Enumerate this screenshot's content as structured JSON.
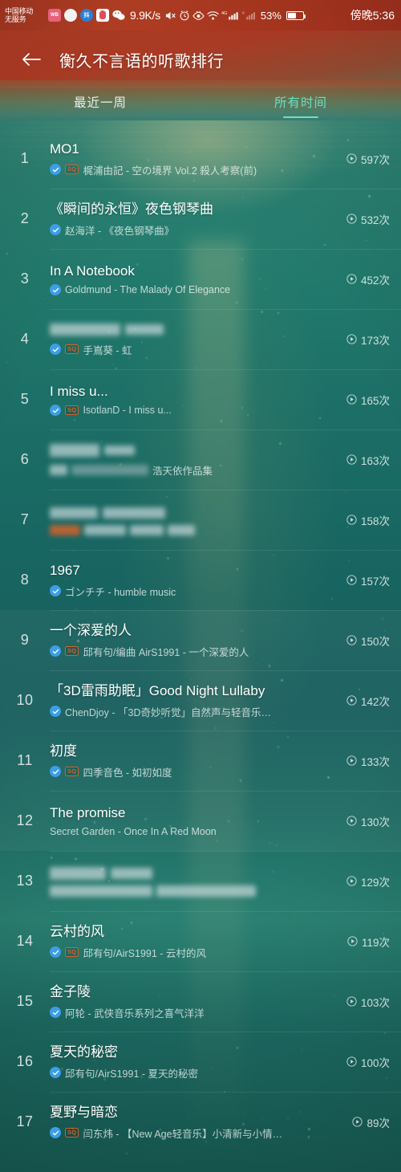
{
  "status_bar": {
    "carrier_line1": "中国移动",
    "carrier_line2": "无服务",
    "network_speed": "9.9K/s",
    "battery_percent": "53%",
    "clock": "傍晚5:36",
    "signal_label_1": "4G",
    "signal_label_2": "✕",
    "notification_icons": [
      "weibo-icon",
      "message-icon",
      "douyin-icon",
      "qq-icon",
      "wechat-icon"
    ],
    "system_icons": [
      "mute-icon",
      "alarm-icon",
      "eye-care-icon",
      "wifi-icon",
      "signal-4g-icon",
      "signal-second-icon",
      "battery-icon"
    ]
  },
  "header": {
    "back_icon": "back-arrow-icon",
    "title": "衡久不言语的听歌排行"
  },
  "tabs": [
    {
      "label": "最近一周",
      "active": false
    },
    {
      "label": "所有时间",
      "active": true
    }
  ],
  "theme": {
    "accent": "#66e3c4",
    "verified_blue": "#3c9ee8",
    "sq_orange": "#d4622a",
    "status_red": "#b93f27",
    "sea_teal": "#186561"
  },
  "plays_unit": "次",
  "songs": [
    {
      "rank": "1",
      "title": "MO1",
      "title_blurred": false,
      "verified": true,
      "sq": true,
      "sq_label": "SQ",
      "artist": "梶浦由記 - 空の境界 Vol.2 殺人考察(前)",
      "artist_blurred": false,
      "plays": "597次",
      "highlight": false
    },
    {
      "rank": "2",
      "title": "《瞬间的永恒》夜色钢琴曲",
      "title_blurred": false,
      "verified": true,
      "sq": false,
      "sq_label": "",
      "artist": "赵海洋 - 《夜色钢琴曲》",
      "artist_blurred": false,
      "plays": "532次",
      "highlight": false
    },
    {
      "rank": "3",
      "title": "In A Notebook",
      "title_blurred": false,
      "verified": true,
      "sq": false,
      "sq_label": "",
      "artist": "Goldmund - The Malady Of Elegance",
      "artist_blurred": false,
      "plays": "452次",
      "highlight": false
    },
    {
      "rank": "4",
      "title": "",
      "title_blurred": true,
      "verified": true,
      "sq": true,
      "sq_label": "SQ",
      "artist": "手嶌葵 - 虹",
      "artist_blurred": false,
      "plays": "173次",
      "highlight": false
    },
    {
      "rank": "5",
      "title": "I miss u...",
      "title_blurred": false,
      "verified": true,
      "sq": true,
      "sq_label": "SQ",
      "artist": "IsotlanD - I miss u...",
      "artist_blurred": false,
      "plays": "165次",
      "highlight": false
    },
    {
      "rank": "6",
      "title": "",
      "title_blurred": true,
      "verified": false,
      "sq": false,
      "sq_label": "",
      "artist": "浩天依作品集",
      "artist_blurred": true,
      "plays": "163次",
      "highlight": false
    },
    {
      "rank": "7",
      "title": "",
      "title_blurred": true,
      "verified": false,
      "sq": false,
      "sq_label": "",
      "artist": "",
      "artist_blurred": true,
      "plays": "158次",
      "highlight": false
    },
    {
      "rank": "8",
      "title": "1967",
      "title_blurred": false,
      "verified": true,
      "sq": false,
      "sq_label": "",
      "artist": "ゴンチチ - humble music",
      "artist_blurred": false,
      "plays": "157次",
      "highlight": false
    },
    {
      "rank": "9",
      "title": "一个深爱的人",
      "title_blurred": false,
      "verified": true,
      "sq": true,
      "sq_label": "SQ",
      "artist": "邱有句/编曲 AirS1991 - 一个深爱的人",
      "artist_blurred": false,
      "plays": "150次",
      "highlight": true
    },
    {
      "rank": "10",
      "title": "「3D雷雨助眠」Good Night Lullaby",
      "title_blurred": false,
      "verified": true,
      "sq": false,
      "sq_label": "",
      "artist": "ChenDjoy - 「3D奇妙听觉」自然声与轻音乐…",
      "artist_blurred": false,
      "plays": "142次",
      "highlight": true
    },
    {
      "rank": "11",
      "title": "初度",
      "title_blurred": false,
      "verified": true,
      "sq": true,
      "sq_label": "SQ",
      "artist": "四季音色 - 如初如度",
      "artist_blurred": false,
      "plays": "133次",
      "highlight": true
    },
    {
      "rank": "12",
      "title": "The promise",
      "title_blurred": false,
      "verified": false,
      "sq": false,
      "sq_label": "",
      "artist": "Secret Garden - Once In A Red Moon",
      "artist_blurred": false,
      "plays": "130次",
      "highlight": true
    },
    {
      "rank": "13",
      "title": "",
      "title_blurred": true,
      "verified": false,
      "sq": false,
      "sq_label": "",
      "artist": "",
      "artist_blurred": true,
      "plays": "129次",
      "highlight": false
    },
    {
      "rank": "14",
      "title": "云村的风",
      "title_blurred": false,
      "verified": true,
      "sq": true,
      "sq_label": "SQ",
      "artist": "邱有句/AirS1991 - 云村的风",
      "artist_blurred": false,
      "plays": "119次",
      "highlight": false
    },
    {
      "rank": "15",
      "title": "金子陵",
      "title_blurred": false,
      "verified": true,
      "sq": false,
      "sq_label": "",
      "artist": "阿轮 - 武侠音乐系列之喜气洋洋",
      "artist_blurred": false,
      "plays": "103次",
      "highlight": false
    },
    {
      "rank": "16",
      "title": "夏天的秘密",
      "title_blurred": false,
      "verified": true,
      "sq": false,
      "sq_label": "",
      "artist": "邱有句/AirS1991 - 夏天的秘密",
      "artist_blurred": false,
      "plays": "100次",
      "highlight": false
    },
    {
      "rank": "17",
      "title": "夏野与暗恋",
      "title_blurred": false,
      "verified": true,
      "sq": true,
      "sq_label": "SQ",
      "artist": "闫东炜 - 【New Age轻音乐】小清新与小情…",
      "artist_blurred": false,
      "plays": "89次",
      "highlight": false
    }
  ]
}
